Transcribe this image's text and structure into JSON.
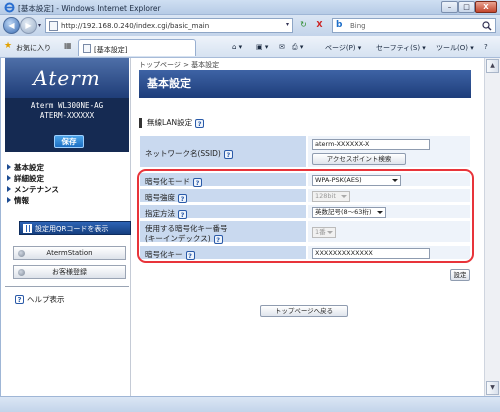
{
  "window": {
    "title": "[基本設定] - Windows Internet Explorer",
    "min": "–",
    "max": "□",
    "close": "X"
  },
  "address": {
    "url": "http://192.168.0.240/index.cgi/basic_main",
    "search_text": "Bing",
    "refresh": "↻",
    "stop": "X"
  },
  "favorites": {
    "label": "お気に入り",
    "tab_title": "[基本設定]",
    "commands": [
      "ページ(P) ▾",
      "セーフティ(S) ▾",
      "ツール(O) ▾"
    ]
  },
  "sidebar": {
    "logo": "Aterm",
    "model_line1": "Aterm WL300NE-AG",
    "model_line2": "ATERM-XXXXXX",
    "save_label": "保存",
    "menu": [
      "基本設定",
      "詳細設定",
      "メンテナンス",
      "情報"
    ],
    "qr_button": "設定用QRコードを表示",
    "aterm_station": "AtermStation",
    "customer_reg": "お客様登録",
    "help": "ヘルプ表示"
  },
  "main": {
    "breadcrumb": "トップページ > 基本設定",
    "page_title": "基本設定",
    "section_title": "無線LAN設定",
    "ssid_label": "ネットワーク名(SSID)",
    "ssid_value": "aterm-XXXXXX-X",
    "ap_search_button": "アクセスポイント検索",
    "encryption_mode_label": "暗号化モード",
    "encryption_mode_value": "WPA-PSK(AES)",
    "encryption_strength_label": "暗号強度",
    "encryption_strength_value": "128bit",
    "method_label": "指定方法",
    "method_value": "英数記号(8〜63桁)",
    "key_index_label_line1": "使用する暗号化キー番号",
    "key_index_label_line2": "(キーインデックス)",
    "key_index_value": "1番",
    "key_label": "暗号化キー",
    "key_value": "XXXXXXXXXXXXX",
    "set_button": "設定",
    "back_button": "トップページへ戻る",
    "help_mark": "?"
  },
  "colors": {
    "accent_blue": "#1d3d7a",
    "highlight_red": "#e8343a"
  }
}
